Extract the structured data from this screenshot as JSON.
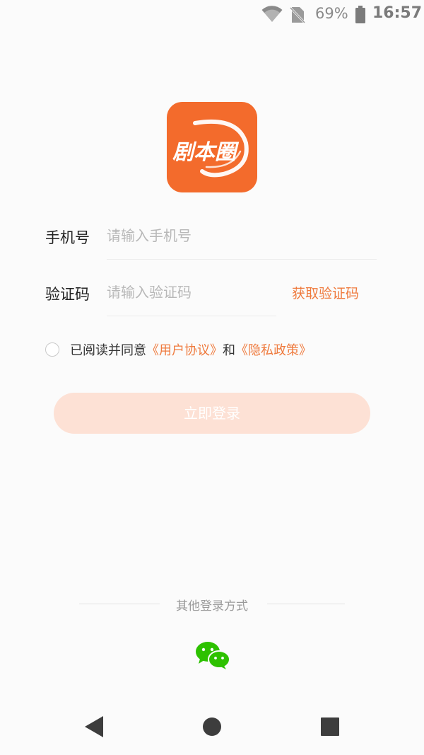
{
  "status_bar": {
    "battery_percent": "69%",
    "time": "16:57",
    "icons": [
      "wifi-icon",
      "no-sim-icon",
      "battery-icon"
    ]
  },
  "logo": {
    "text": "剧本圈",
    "color": "#f36b2c"
  },
  "form": {
    "phone_label": "手机号",
    "phone_placeholder": "请输入手机号",
    "code_label": "验证码",
    "code_placeholder": "请输入验证码",
    "get_code": "获取验证码"
  },
  "agreement": {
    "prefix": "已阅读并同意",
    "user_agreement": "《用户协议》",
    "conjunction": "和",
    "privacy_policy": "《隐私政策》"
  },
  "login_button": "立即登录",
  "other_login": {
    "label": "其他登录方式",
    "methods": [
      "wechat-icon"
    ]
  },
  "nav_bar": {
    "buttons": [
      "back-icon",
      "home-icon",
      "recent-apps-icon"
    ]
  },
  "colors": {
    "accent": "#ef7a3d",
    "button_disabled": "#fde1d5",
    "wechat": "#2dc100"
  }
}
